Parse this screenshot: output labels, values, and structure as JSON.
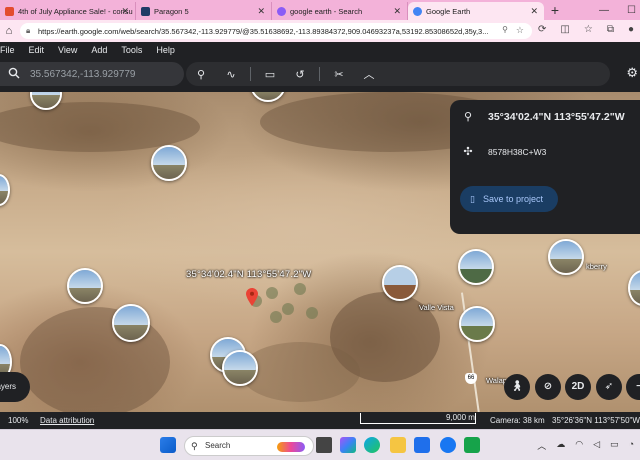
{
  "tabs": [
    {
      "title": "4th of July Appliance Sale! - consu",
      "color": "#e34b2e",
      "active": false
    },
    {
      "title": "Paragon 5",
      "color": "#1f3b66",
      "active": false
    },
    {
      "title": "google earth - Search",
      "color": "#8b5cf6",
      "active": false
    },
    {
      "title": "Google Earth",
      "color": "#4285f4",
      "active": true
    }
  ],
  "browser": {
    "url": "https://earth.google.com/web/search/35.567342,-113.929779/@35.51638692,-113.89384372,909.04693237a,53192.85308652d,35y,3...",
    "new_tab": "+"
  },
  "menu": [
    "File",
    "Edit",
    "View",
    "Add",
    "Tools",
    "Help"
  ],
  "search": {
    "placeholder": "35.567342,-113.929779"
  },
  "map": {
    "coord_label": "35°34'02.4\"N 113°55'47.2\"W",
    "places": {
      "valle_vista": "Valle Vista",
      "berry": "kberry",
      "walap": "Walap"
    },
    "route_shield": "66"
  },
  "info_panel": {
    "coordinates": "35°34'02.4\"N 113°55'47.2\"W",
    "plus_code": "8578H38C+W3",
    "save_button": "Save to project"
  },
  "controls": {
    "mode_2d": "2D",
    "layers": "Layers"
  },
  "status": {
    "zoom": "100%",
    "attribution": "Data attribution",
    "scale": "9,000 m",
    "camera": "Camera: 38 km",
    "position": "35°26'36\"N 113°57'50\"W"
  },
  "taskbar": {
    "search_placeholder": "Search"
  }
}
